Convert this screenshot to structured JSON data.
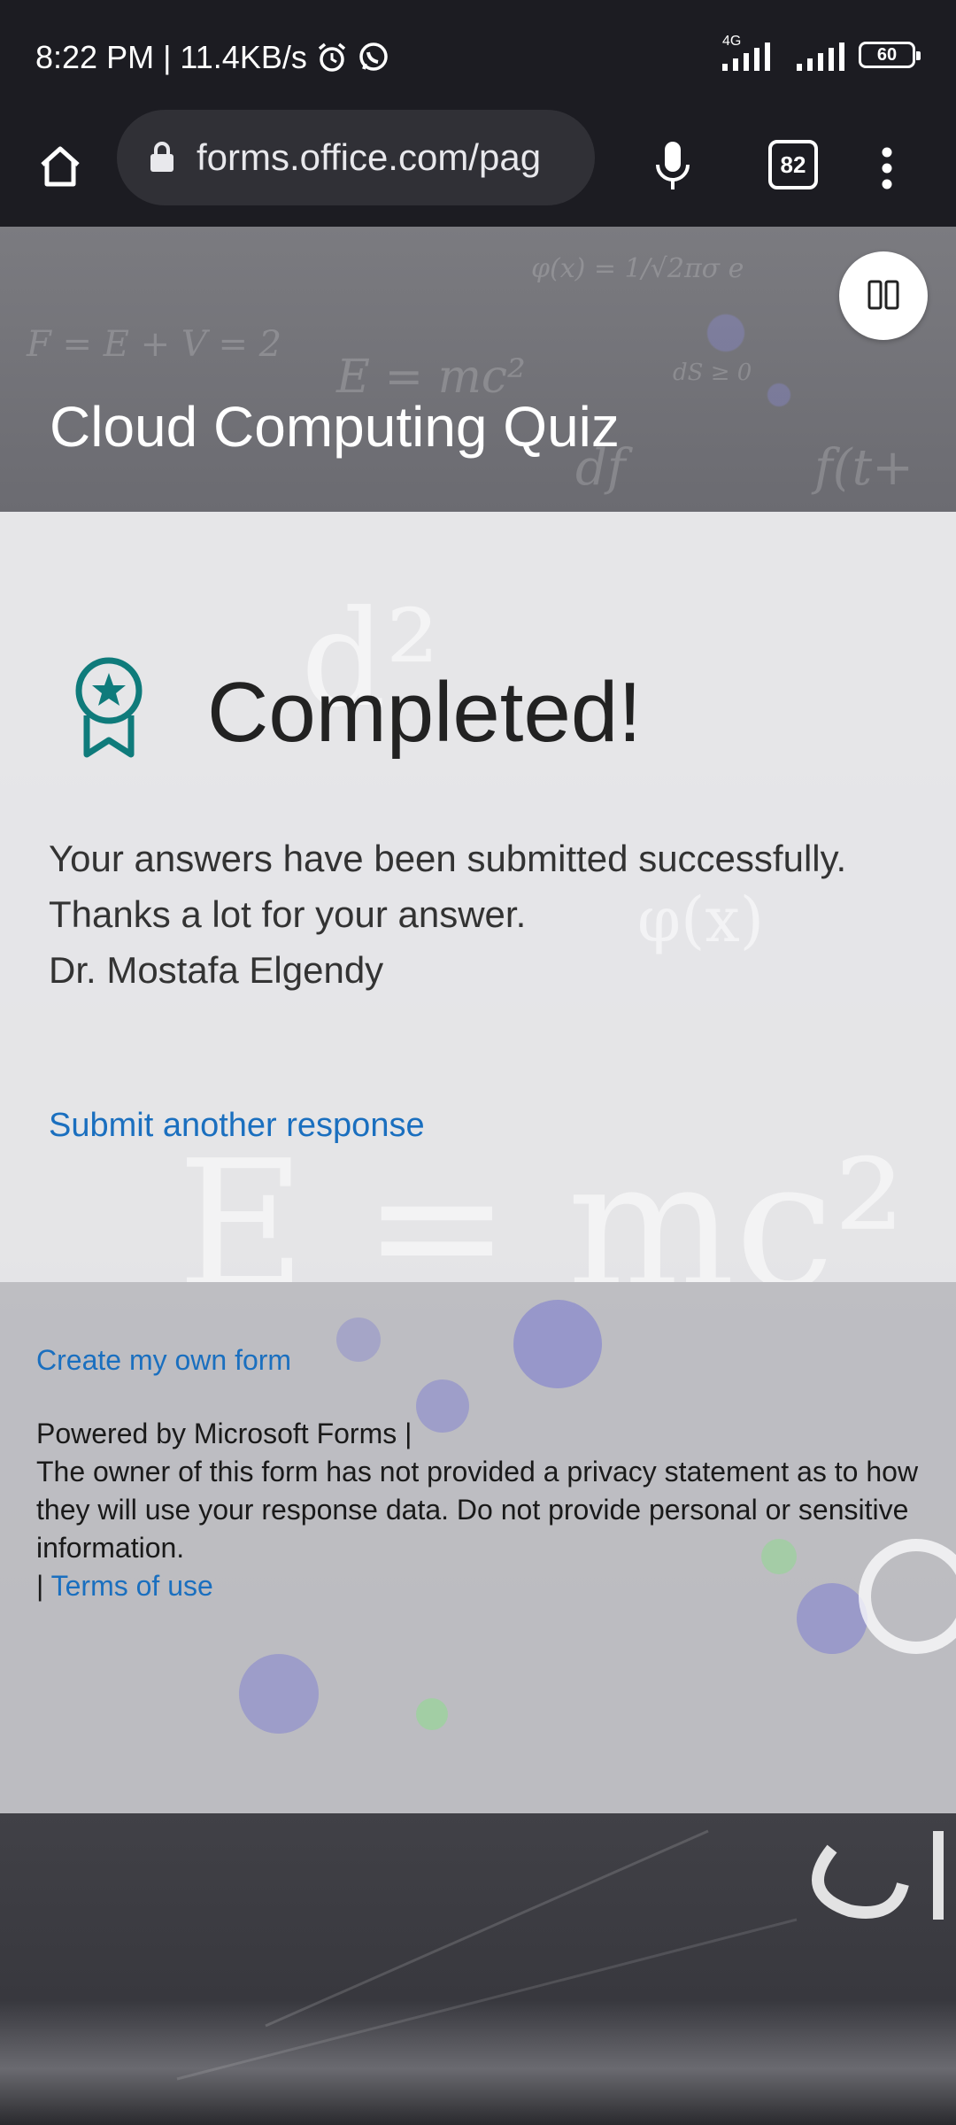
{
  "status_bar": {
    "time_speed": "8:22 PM | 11.4KB/s",
    "network_label": "4G",
    "battery_level": "60",
    "icons": [
      "alarm-icon",
      "whatsapp-icon",
      "signal-icon",
      "wifi-signal-icon",
      "battery-icon"
    ]
  },
  "browser": {
    "url": "forms.office.com/pag",
    "tab_count": "82",
    "icons": [
      "home-icon",
      "lock-icon",
      "mic-icon",
      "tabs-icon",
      "more-vert-icon"
    ]
  },
  "hero": {
    "title": "Cloud Computing Quiz",
    "immersive_reader_icon": "immersive-reader-icon"
  },
  "completion": {
    "badge_icon": "award-ribbon-icon",
    "heading": "Completed!",
    "message_lines": [
      "Your answers have been submitted successfully.",
      "Thanks a lot for your answer.",
      "Dr. Mostafa Elgendy"
    ],
    "submit_another": "Submit another response"
  },
  "footer": {
    "create_form": "Create my own form",
    "powered_by": "Powered by Microsoft Forms |",
    "privacy_note": "The owner of this form has not provided a privacy statement as to how they will use your response data. Do not provide personal or sensitive information.",
    "separator": "|",
    "terms": "Terms of use"
  },
  "colors": {
    "accent_teal": "#0f7b7b",
    "link_blue": "#1a6fbf",
    "chrome_dark": "#1c1c22"
  }
}
